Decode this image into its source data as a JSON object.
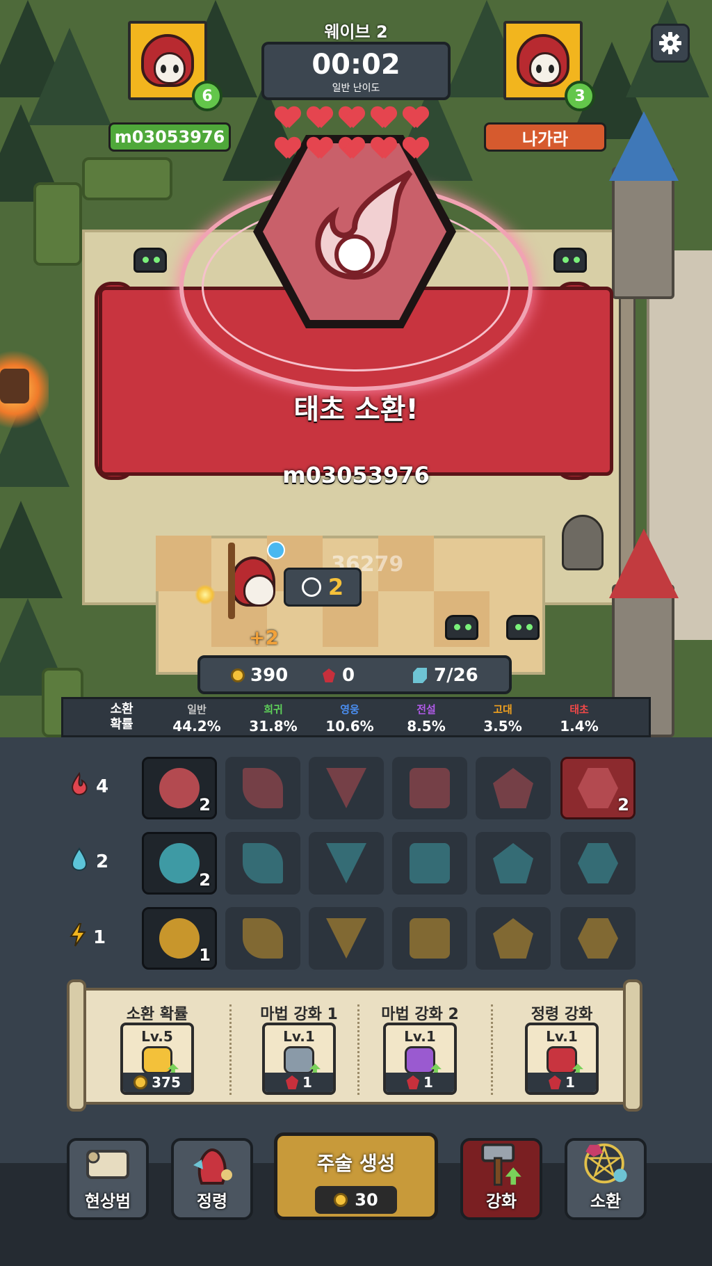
{
  "hud": {
    "wave_label": "웨이브 2",
    "timer": "00:02",
    "difficulty": "일반 난이도",
    "hearts_count": 10,
    "settings_icon": "gear-icon"
  },
  "player_left": {
    "name": "m03053976",
    "level": "6",
    "color": "#4fa83a"
  },
  "player_right": {
    "name": "나가라",
    "level": "3",
    "color": "#d65a2e"
  },
  "summon_banner": {
    "title": "태초 소환!",
    "player": "m03053976",
    "icon": "fireball-icon",
    "accent": "#c8343f"
  },
  "field": {
    "floating_damage": "36279",
    "cooldown": "2",
    "float_plus": "+2"
  },
  "resources": {
    "gold": "390",
    "ruby": "0",
    "capacity": "7/26"
  },
  "summon_rates": {
    "label": "소환\n확률",
    "tiers": [
      {
        "name": "일반",
        "rate": "44.2%",
        "color": "#c9c9c9"
      },
      {
        "name": "희귀",
        "rate": "31.8%",
        "color": "#5fd35a"
      },
      {
        "name": "영웅",
        "rate": "10.6%",
        "color": "#4a8ef0"
      },
      {
        "name": "전설",
        "rate": "8.5%",
        "color": "#b05ae8"
      },
      {
        "name": "고대",
        "rate": "3.5%",
        "color": "#f2a21e"
      },
      {
        "name": "태초",
        "rate": "1.4%",
        "color": "#f04848"
      }
    ]
  },
  "element_rows": [
    {
      "element": "fire",
      "icon": "fire-drop-icon",
      "count": "4",
      "color": "#b34a50",
      "slots": [
        {
          "shape": "circ",
          "count": "2",
          "state": "owned"
        },
        {
          "shape": "leaf",
          "state": "locked"
        },
        {
          "shape": "tri",
          "state": "locked"
        },
        {
          "shape": "sq",
          "state": "locked"
        },
        {
          "shape": "pent",
          "state": "locked"
        },
        {
          "shape": "hex",
          "count": "2",
          "state": "owned-red"
        }
      ]
    },
    {
      "element": "water",
      "icon": "water-drop-icon",
      "count": "2",
      "color": "#3e9aa4",
      "slots": [
        {
          "shape": "circ",
          "count": "2",
          "state": "owned"
        },
        {
          "shape": "leaf",
          "state": "locked"
        },
        {
          "shape": "tri",
          "state": "locked"
        },
        {
          "shape": "sq",
          "state": "locked"
        },
        {
          "shape": "pent",
          "state": "locked"
        },
        {
          "shape": "hex",
          "state": "locked"
        }
      ]
    },
    {
      "element": "lightning",
      "icon": "lightning-icon",
      "count": "1",
      "color": "#c8962c",
      "slots": [
        {
          "shape": "circ",
          "count": "1",
          "state": "owned"
        },
        {
          "shape": "leaf",
          "state": "locked"
        },
        {
          "shape": "tri",
          "state": "locked"
        },
        {
          "shape": "sq",
          "state": "locked"
        },
        {
          "shape": "pent",
          "state": "locked"
        },
        {
          "shape": "hex",
          "state": "locked"
        }
      ]
    }
  ],
  "upgrades": [
    {
      "title": "소환 확률",
      "level": "Lv.5",
      "cost": "375",
      "currency": "coin-icon",
      "icon": "percent-potion-icon"
    },
    {
      "title": "마법 강화 1",
      "level": "Lv.1",
      "cost": "1",
      "currency": "ruby-icon",
      "icon": "magic-upgrade-1-icon"
    },
    {
      "title": "마법 강화 2",
      "level": "Lv.1",
      "cost": "1",
      "currency": "ruby-icon",
      "icon": "magic-upgrade-2-icon"
    },
    {
      "title": "정령 강화",
      "level": "Lv.1",
      "cost": "1",
      "currency": "ruby-icon",
      "icon": "spirit-upgrade-icon"
    }
  ],
  "nav": {
    "grimoire": "현상범",
    "spirit": "정령",
    "create_title": "주술 생성",
    "create_cost": "30",
    "upgrade": "강화",
    "summon": "소환"
  }
}
